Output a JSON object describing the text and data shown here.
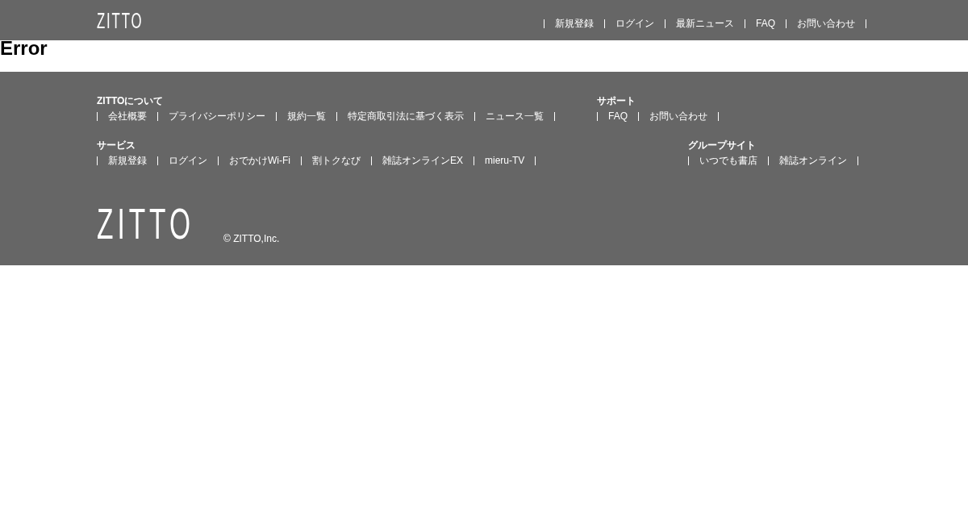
{
  "header": {
    "logo": "ZITTO",
    "nav": [
      "新規登録",
      "ログイン",
      "最新ニュース",
      "FAQ",
      "お問い合わせ"
    ]
  },
  "main": {
    "title": "Error"
  },
  "footer": {
    "rows": [
      {
        "groups": [
          {
            "title": "ZITTOについて",
            "links": [
              "会社概要",
              "プライバシーポリシー",
              "規約一覧",
              "特定商取引法に基づく表示",
              "ニュース一覧"
            ]
          },
          {
            "title": "サポート",
            "links": [
              "FAQ",
              "お問い合わせ"
            ]
          }
        ]
      },
      {
        "groups": [
          {
            "title": "サービス",
            "links": [
              "新規登録",
              "ログイン",
              "おでかけWi-Fi",
              "割トクなび",
              "雑誌オンラインEX",
              "mieru-TV"
            ]
          },
          {
            "title": "グループサイト",
            "links": [
              "いつでも書店",
              "雑誌オンライン"
            ]
          }
        ]
      }
    ],
    "logo": "ZITTO",
    "copyright": "© ZITTO,Inc."
  }
}
